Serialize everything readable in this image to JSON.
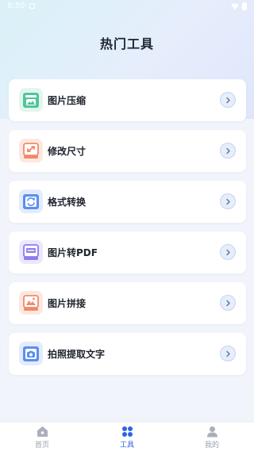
{
  "status_bar": {
    "time": "8:50"
  },
  "header": {
    "title": "热门工具"
  },
  "tools": [
    {
      "label": "图片压缩",
      "icon": "image-compress-icon",
      "color": "#4fc59a"
    },
    {
      "label": "修改尺寸",
      "icon": "resize-icon",
      "color": "#f08a6a"
    },
    {
      "label": "格式转换",
      "icon": "format-convert-icon",
      "color": "#5b8ef0"
    },
    {
      "label": "图片转PDF",
      "icon": "image-to-pdf-icon",
      "color": "#8a7df0"
    },
    {
      "label": "图片拼接",
      "icon": "image-stitch-icon",
      "color": "#f08a6a"
    },
    {
      "label": "拍照提取文字",
      "icon": "photo-ocr-icon",
      "color": "#5b8ef0"
    }
  ],
  "tabbar": {
    "items": [
      {
        "label": "首页",
        "icon": "home-icon",
        "active": false
      },
      {
        "label": "工具",
        "icon": "tools-grid-icon",
        "active": true
      },
      {
        "label": "我的",
        "icon": "profile-icon",
        "active": false
      }
    ],
    "active_color": "#2e63e8",
    "inactive_color": "#9aa0ab"
  }
}
